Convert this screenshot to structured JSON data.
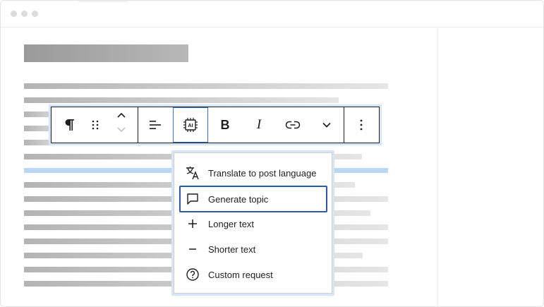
{
  "toolbar": {
    "paragraph_icon": "pilcrow-icon",
    "bold_label": "B",
    "italic_label": "I",
    "ai_label": "AI"
  },
  "menu": {
    "items": [
      {
        "label": "Translate to post language",
        "icon": "translate-icon"
      },
      {
        "label": "Generate topic",
        "icon": "speech-bubble-icon"
      },
      {
        "label": "Longer text",
        "icon": "plus-icon"
      },
      {
        "label": "Shorter text",
        "icon": "minus-icon"
      },
      {
        "label": "Custom request",
        "icon": "question-circle-icon"
      }
    ],
    "active_index": 1
  },
  "colors": {
    "accent": "#2f5aa8",
    "selection": "#bcd6f5",
    "focus_ring": "#d6e5f7"
  }
}
